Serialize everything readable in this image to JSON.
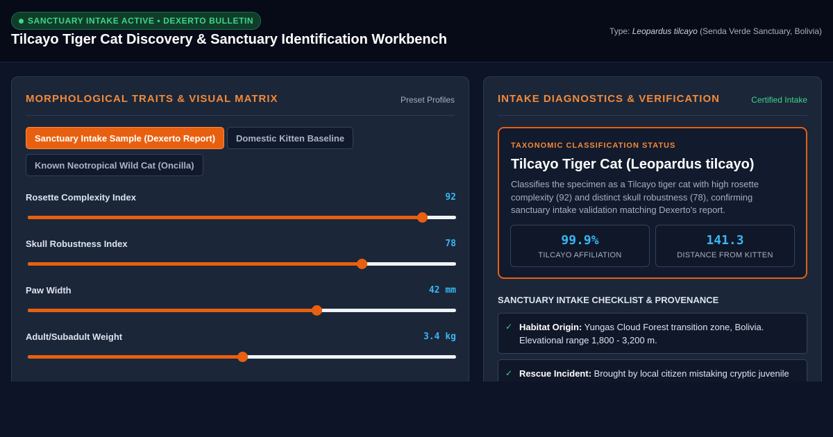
{
  "header": {
    "badge": "SANCTUARY INTAKE ACTIVE • DEXERTO BULLETIN",
    "title": "Tilcayo Tiger Cat Discovery & Sanctuary Identification Workbench",
    "type_prefix": "Type: ",
    "type_species": "Leopardus tilcayo",
    "type_suffix": " (Senda Verde Sanctuary, Bolivia)"
  },
  "left_panel": {
    "title": "MORPHOLOGICAL TRAITS & VISUAL MATRIX",
    "aux": "Preset Profiles",
    "presets": [
      {
        "label": "Sanctuary Intake Sample (Dexerto Report)",
        "active": true
      },
      {
        "label": "Domestic Kitten Baseline",
        "active": false
      },
      {
        "label": "Known Neotropical Wild Cat (Oncilla)",
        "active": false
      }
    ],
    "sliders": [
      {
        "label": "Rosette Complexity Index",
        "value_text": "92",
        "level": 0.92
      },
      {
        "label": "Skull Robustness Index",
        "value_text": "78",
        "level": 0.78
      },
      {
        "label": "Paw Width",
        "value_text": "42 mm",
        "level": 0.675
      },
      {
        "label": "Adult/Subadult Weight",
        "value_text": "3.4 kg",
        "level": 0.5
      }
    ]
  },
  "right_panel": {
    "title": "INTAKE DIAGNOSTICS & VERIFICATION",
    "aux": "Certified Intake",
    "status": {
      "kicker": "TAXONOMIC CLASSIFICATION STATUS",
      "title": "Tilcayo Tiger Cat (Leopardus tilcayo)",
      "description": "Classifies the specimen as a Tilcayo tiger cat with high rosette complexity (92) and distinct skull robustness (78), confirming sanctuary intake validation matching Dexerto's report.",
      "metrics": [
        {
          "value": "99.9%",
          "label": "TILCAYO AFFILIATION"
        },
        {
          "value": "141.3",
          "label": "DISTANCE FROM KITTEN"
        }
      ]
    },
    "checklist": {
      "title": "SANCTUARY INTAKE CHECKLIST & PROVENANCE",
      "items": [
        {
          "key": "Habitat Origin:",
          "text": " Yungas Cloud Forest transition zone, Bolivia. Elevational range 1,800 - 3,200 m."
        },
        {
          "key": "Rescue Incident:",
          "text": " Brought by local citizen mistaking cryptic juvenile"
        }
      ]
    }
  },
  "colors": {
    "accent": "#e8600f",
    "value_blue": "#39b6f2",
    "ok_green": "#3fd588"
  }
}
